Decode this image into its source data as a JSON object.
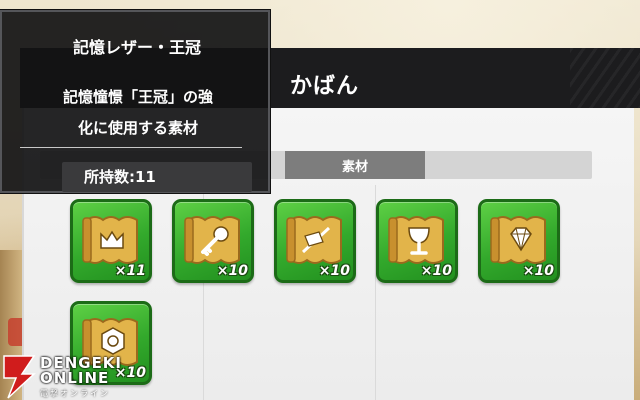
{
  "bag": {
    "title": "かばん",
    "tab_label": "素材"
  },
  "tooltip": {
    "item_name": "記憶レザー・王冠",
    "description_line1": "記憶憧憬「王冠」の強",
    "description_line2": "化に使用する素材",
    "owned_label": "所持数:11"
  },
  "items": [
    {
      "icon": "crown-scroll-icon",
      "count": "×11"
    },
    {
      "icon": "key-scroll-icon",
      "count": "×10"
    },
    {
      "icon": "flag-scroll-icon",
      "count": "×10"
    },
    {
      "icon": "goblet-scroll-icon",
      "count": "×10"
    },
    {
      "icon": "gem-scroll-icon",
      "count": "×10"
    },
    {
      "icon": "emblem-scroll-icon",
      "count": "×10"
    }
  ],
  "watermark": {
    "line1": "DENGEKI",
    "line2": "ONLINE",
    "line3": "電撃オンライン"
  },
  "colors": {
    "item_green": "#33a92c",
    "scroll_gold": "#e2b44a",
    "header_dark": "#1c1c1e",
    "watermark_red": "#d01c1c"
  }
}
